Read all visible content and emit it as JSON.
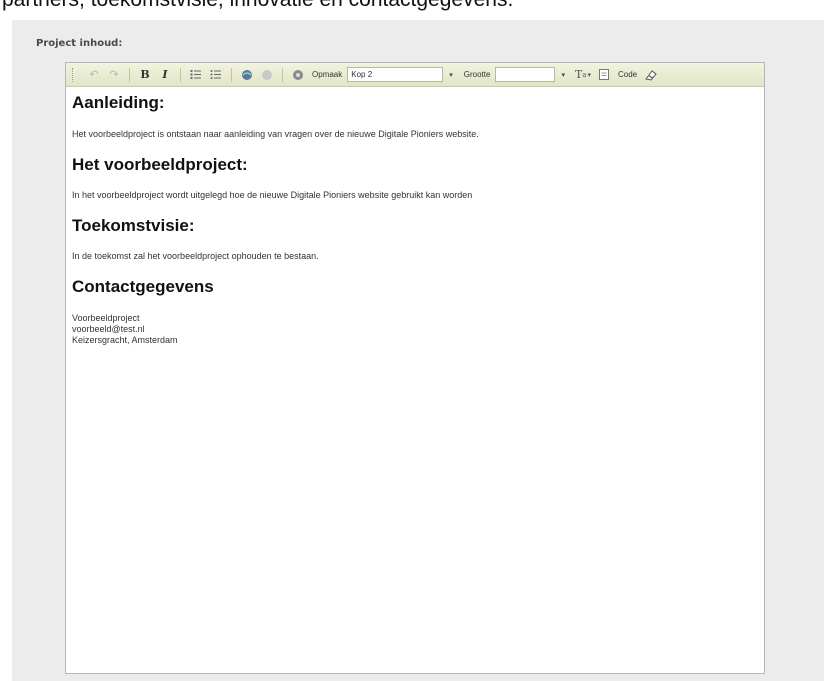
{
  "intro": {
    "text": "partners, toekomstvisie, innovatie en contactgegevens."
  },
  "form": {
    "label": "Project inhoud:"
  },
  "toolbar": {
    "bold_label": "B",
    "italic_label": "I",
    "format_label": "Opmaak",
    "format_value": "Kop 2",
    "size_label": "Grootte",
    "size_value": "",
    "code_label": "Code"
  },
  "content": {
    "sections": [
      {
        "heading": "Aanleiding:",
        "body": "Het voorbeeldproject is ontstaan naar aanleiding van vragen over de nieuwe Digitale Pioniers website."
      },
      {
        "heading": "Het voorbeeldproject:",
        "body": "In het voorbeeldproject wordt uitgelegd hoe de nieuwe Digitale Pioniers website gebruikt kan worden"
      },
      {
        "heading": "Toekomstvisie:",
        "body": "In de toekomst zal het voorbeeldproject ophouden te bestaan."
      },
      {
        "heading": "Contactgegevens",
        "lines": [
          "Voorbeeldproject",
          "voorbeeld@test.nl",
          "Keizersgracht, Amsterdam"
        ]
      }
    ]
  },
  "icons": [
    "undo-icon",
    "redo-icon",
    "ordered-list-icon",
    "unordered-list-icon",
    "link-icon",
    "unlink-icon",
    "image-icon",
    "text-color-icon",
    "source-code-icon",
    "eraser-icon"
  ]
}
